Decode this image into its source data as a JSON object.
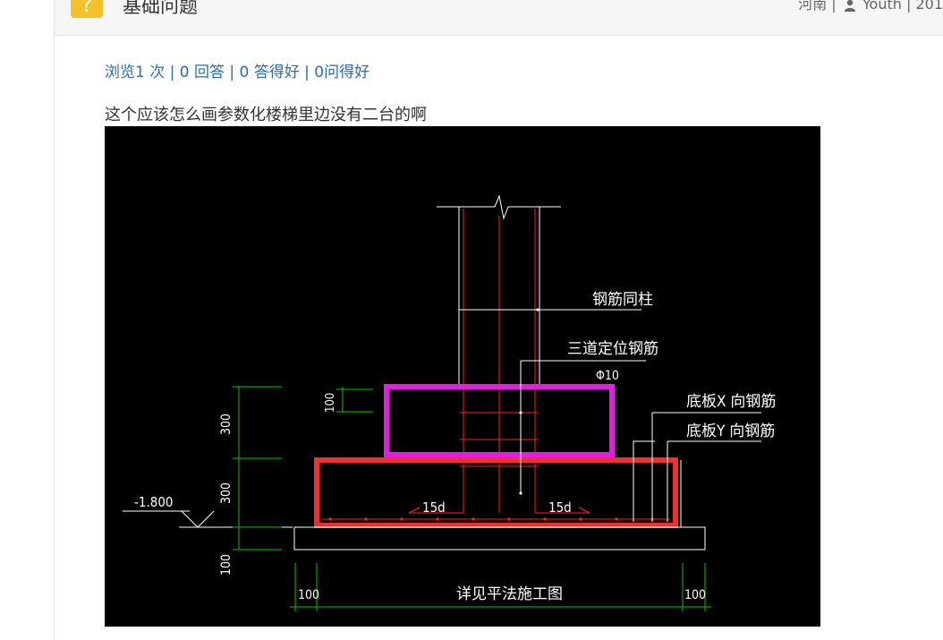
{
  "header": {
    "badge": "?",
    "title": "基础问题",
    "meta_location": "河南 |",
    "meta_user": "Youth",
    "meta_date": "| 201"
  },
  "stats": "浏览1 次 | 0 回答 | 0 答得好 | 0问得好",
  "question": "这个应该怎么画参数化楼梯里边没有二台的啊",
  "drawing": {
    "labels": {
      "rebar_same_column": "钢筋同柱",
      "three_positioning_bars": "三道定位钢筋",
      "phi10": "Φ10",
      "bottom_x": "底板X 向钢筋",
      "bottom_y": "底板Y 向钢筋",
      "elevation": "-1.800",
      "dim_300_top": "300",
      "dim_300_bottom": "300",
      "dim_100_left": "100",
      "dim_100_top": "100",
      "anchor_left": "15d",
      "anchor_right": "15d",
      "dim_100_bl": "100",
      "dim_100_br": "100",
      "see_drawing": "详见平法施工图"
    },
    "colors": {
      "background": "#000000",
      "line": "#ffffff",
      "rebar": "#ff2020",
      "dimension": "#00c800",
      "step_top": "#e020e0",
      "step_bottom": "#f03030"
    }
  }
}
